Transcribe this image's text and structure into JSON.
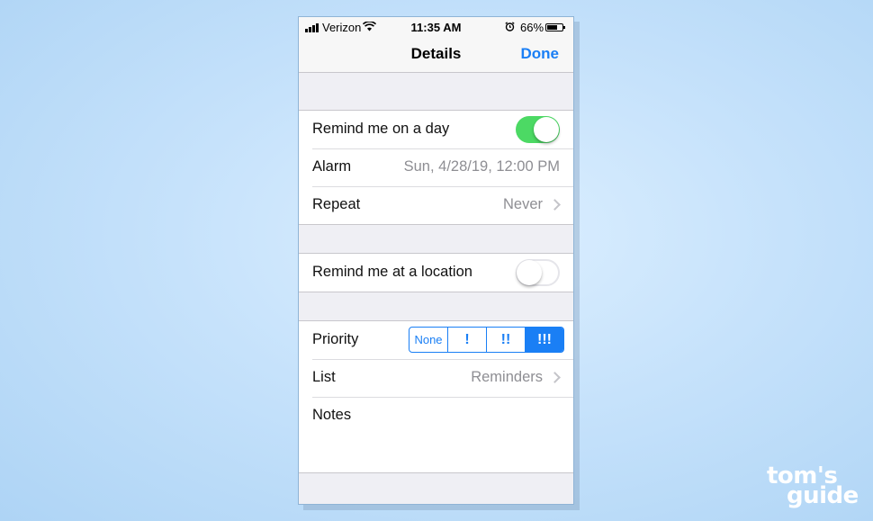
{
  "status_bar": {
    "carrier": "Verizon",
    "time": "11:35 AM",
    "battery_percent": "66%",
    "battery_level": 0.66,
    "icons": [
      "signal-bars-icon",
      "wifi-icon",
      "alarm-clock-icon",
      "battery-icon"
    ]
  },
  "nav": {
    "title": "Details",
    "done_label": "Done"
  },
  "schedule": {
    "remind_day_label": "Remind me on a day",
    "remind_day_on": true,
    "alarm_label": "Alarm",
    "alarm_value": "Sun, 4/28/19, 12:00 PM",
    "repeat_label": "Repeat",
    "repeat_value": "Never"
  },
  "location": {
    "remind_location_label": "Remind me at a location",
    "remind_location_on": false
  },
  "details": {
    "priority_label": "Priority",
    "priority_options": [
      "None",
      "!",
      "!!",
      "!!!"
    ],
    "priority_selected": "!!!",
    "list_label": "List",
    "list_value": "Reminders",
    "notes_label": "Notes"
  },
  "watermark": {
    "line1": "tom's",
    "line2": "guide"
  },
  "colors": {
    "accent": "#1a7ff5",
    "toggle_on": "#4cd964",
    "background": "#c6e2fb"
  }
}
